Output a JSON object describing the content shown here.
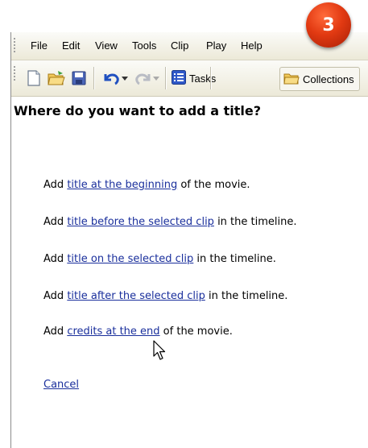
{
  "badge": {
    "number": "3"
  },
  "menu": {
    "items": [
      "File",
      "Edit",
      "View",
      "Tools",
      "Clip",
      "Play",
      "Help"
    ]
  },
  "toolbar": {
    "tasks_label": "Tasks",
    "collections_label": "Collections"
  },
  "heading": "Where do you want to add a title?",
  "options": [
    {
      "prefix": "Add ",
      "link": "title at the beginning",
      "suffix": " of the movie."
    },
    {
      "prefix": "Add ",
      "link": "title before the selected clip",
      "suffix": " in the timeline."
    },
    {
      "prefix": "Add ",
      "link": "title on the selected clip",
      "suffix": " in the timeline."
    },
    {
      "prefix": "Add ",
      "link": "title after the selected clip",
      "suffix": " in the timeline."
    },
    {
      "prefix": "Add ",
      "link": "credits at the end",
      "suffix": " of the movie."
    }
  ],
  "cancel_label": "Cancel",
  "colors": {
    "link": "#1a2f9c",
    "badge": "#e23a12",
    "toolbar_bg": "#ece9d8"
  }
}
